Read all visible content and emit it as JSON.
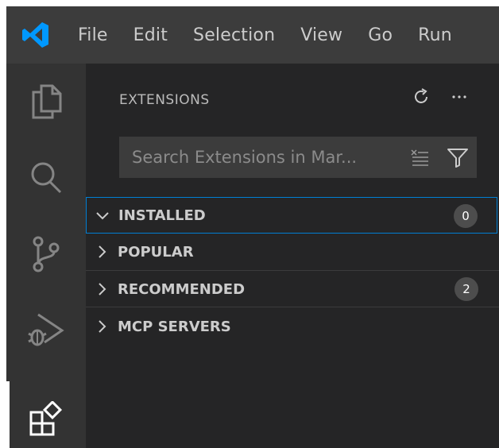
{
  "menubar": {
    "items": [
      "File",
      "Edit",
      "Selection",
      "View",
      "Go",
      "Run"
    ]
  },
  "sidebar": {
    "title": "EXTENSIONS",
    "search": {
      "placeholder": "Search Extensions in Mar...",
      "value": ""
    },
    "sections": [
      {
        "label": "INSTALLED",
        "expanded": true,
        "focused": true,
        "badge": "0"
      },
      {
        "label": "POPULAR",
        "expanded": false,
        "focused": false,
        "badge": ""
      },
      {
        "label": "RECOMMENDED",
        "expanded": false,
        "focused": false,
        "badge": "2"
      },
      {
        "label": "MCP SERVERS",
        "expanded": false,
        "focused": false,
        "badge": ""
      }
    ]
  },
  "activitybar": {
    "items": [
      "explorer-icon",
      "search-icon",
      "source-control-icon",
      "run-debug-icon",
      "extensions-icon"
    ],
    "active": "extensions-icon"
  },
  "colors": {
    "accent": "#007fd4",
    "logo": "#0098ff",
    "titlebar": "#3c3c3c",
    "activitybar": "#333333",
    "sidebar": "#252526"
  }
}
